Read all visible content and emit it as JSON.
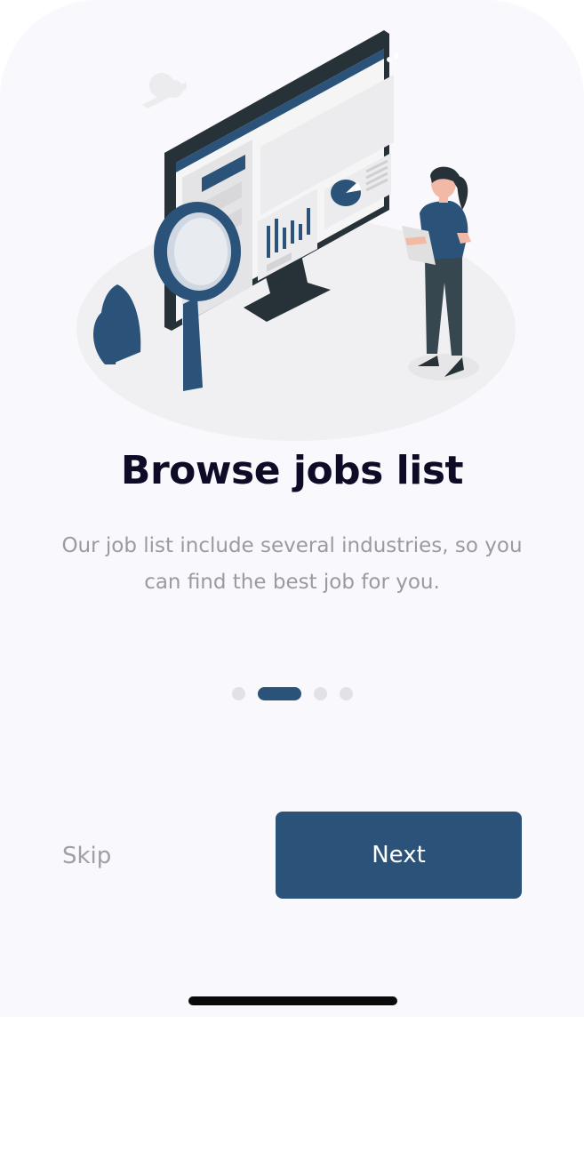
{
  "onboarding": {
    "title": "Browse jobs list",
    "description": "Our job list include several  industries, so you can find the best job for you.",
    "pager": {
      "total_pages": 4,
      "current_page": 2
    },
    "skip_label": "Skip",
    "next_label": "Next"
  },
  "colors": {
    "accent": "#2b5379",
    "background": "#f9f8fd",
    "title": "#0d0b26",
    "muted": "#9a9a9f"
  },
  "illustration": {
    "name": "job-search-illustration"
  }
}
